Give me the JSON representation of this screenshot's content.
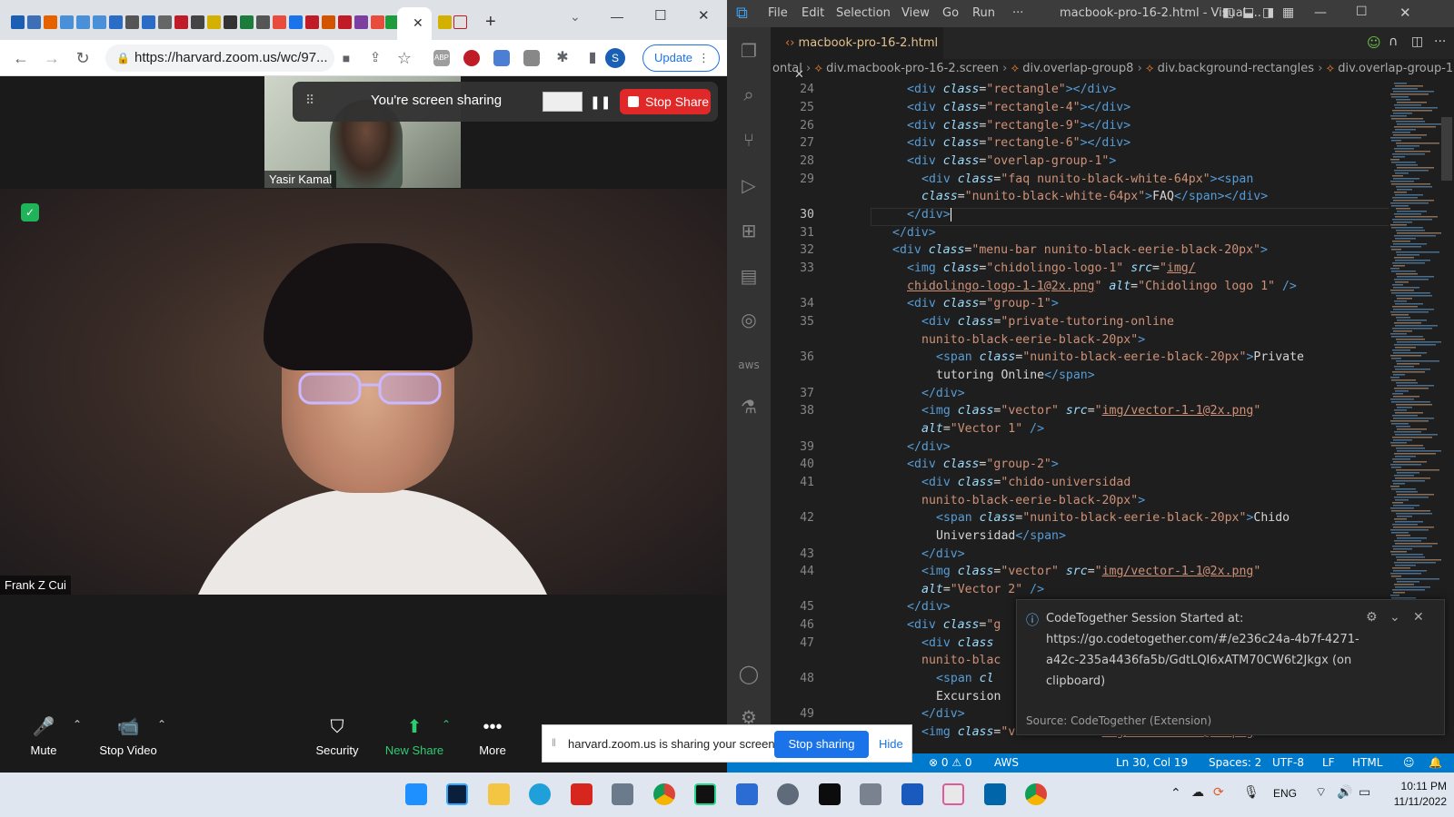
{
  "chrome": {
    "url": "https://harvard.zoom.us/wc/97...",
    "update_label": "Update",
    "profile_initial": "S",
    "abp_label": "ABP"
  },
  "zoom": {
    "thumbnail_name": "Yasir Kamal",
    "main_name": "Frank Z Cui",
    "share_banner_text": "You're screen sharing",
    "stop_share_label": "Stop Share",
    "controls": {
      "mute": "Mute",
      "stop_video": "Stop Video",
      "security": "Security",
      "new_share": "New Share",
      "more": "More"
    }
  },
  "share_notice": {
    "text": "harvard.zoom.us is sharing your screen.",
    "stop_label": "Stop sharing",
    "hide_label": "Hide"
  },
  "vscode": {
    "title": "macbook-pro-16-2.html - Visual ...",
    "menu": [
      "File",
      "Edit",
      "Selection",
      "View",
      "Go",
      "Run",
      "···"
    ],
    "tab_label": "macbook-pro-16-2.html",
    "breadcrumb": [
      "ontal",
      "div.macbook-pro-16-2.screen",
      "div.overlap-group8",
      "div.background-rectangles",
      "div.overlap-group-1"
    ],
    "line_numbers": [
      "24",
      "25",
      "26",
      "27",
      "28",
      "29",
      "",
      "30",
      "31",
      "32",
      "33",
      "",
      "34",
      "35",
      "",
      "36",
      "",
      "37",
      "38",
      "",
      "39",
      "40",
      "41",
      "",
      "42",
      "",
      "43",
      "44",
      "",
      "45",
      "46",
      "47",
      "",
      "48",
      "",
      "49"
    ],
    "current_line": "30",
    "aws_label": "aws",
    "status": {
      "position": "Ln 30, Col 19",
      "spaces": "Spaces: 2",
      "encoding": "UTF-8",
      "eol": "LF",
      "language": "HTML",
      "problems": "⊗ 0 ⚠ 0",
      "aws": "AWS"
    },
    "toast": {
      "title": "CodeTogether Session Started at:",
      "url_line1": "https://go.codetogether.com/#/e236c24a-4b7f-4271-",
      "url_line2": "a42c-235a4436fa5b/GdtLQI6xATM70CW6t2Jkgx (on",
      "url_line3": "clipboard)",
      "source": "Source: CodeTogether (Extension)"
    }
  },
  "taskbar": {
    "lang": "ENG",
    "time": "10:11 PM",
    "date": "11/11/2022"
  },
  "colors": {
    "vscode_blue": "#007acc",
    "zoom_red": "#e02828",
    "chrome_blue": "#1a73e8",
    "share_green": "#1fb35a"
  }
}
